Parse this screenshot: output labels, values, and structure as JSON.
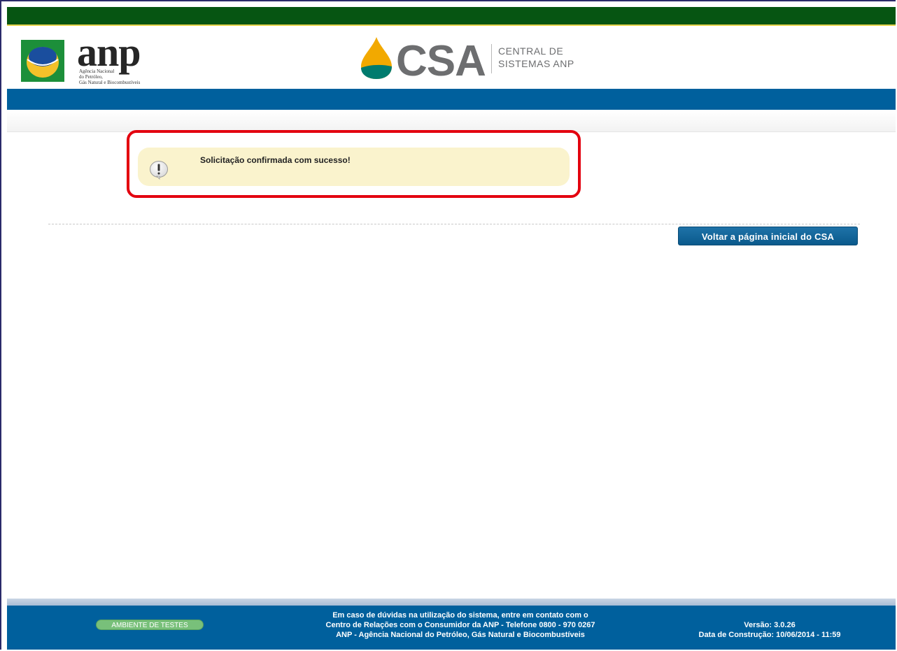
{
  "header": {
    "anp_logo_text": "anp",
    "anp_subtitle": [
      "Agência Nacional",
      "do Petróleo,",
      "Gás Natural e Biocombustíveis"
    ],
    "csa_logo_text": "CSA",
    "csa_tagline": [
      "CENTRAL DE",
      "SISTEMAS ANP"
    ]
  },
  "message": {
    "text": "Solicitação confirmada com sucesso!",
    "icon": "exclamation-bubble-icon"
  },
  "actions": {
    "back_label": "Voltar a página inicial do CSA"
  },
  "footer": {
    "env_badge": "AMBIENTE DE TESTES",
    "contact_lines": [
      "Em caso de dúvidas na utilização do sistema, entre em contato com o",
      "Centro de Relações com o Consumidor da ANP - Telefone 0800 - 970 0267",
      "ANP - Agência Nacional do Petróleo, Gás Natural e Biocombustíveis"
    ],
    "version": "Versão: 3.0.26",
    "build_date": "Data de Construção: 10/06/2014 - 11:59"
  },
  "colors": {
    "top_bar": "#065512",
    "accent_blue": "#00609d",
    "message_bg": "#faf3cd",
    "highlight_red": "#e3000f",
    "badge_green": "#78c07a"
  }
}
